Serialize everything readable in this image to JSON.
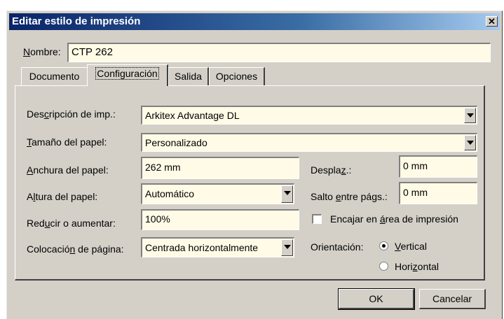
{
  "window": {
    "title": "Editar estilo de impresión",
    "close_symbol": "✕"
  },
  "nombre": {
    "label_u": "N",
    "label_rest": "ombre:",
    "value": "CTP 262"
  },
  "tabs": [
    {
      "label": "Documento"
    },
    {
      "label": "Configuración",
      "active": true
    },
    {
      "label": "Salida"
    },
    {
      "label": "Opciones"
    }
  ],
  "config": {
    "descripcion": {
      "pre": "Des",
      "u": "c",
      "post": "ripción de imp.:",
      "value": "Arkitex Advantage DL"
    },
    "tamano": {
      "pre": "",
      "u": "T",
      "post": "amaño del papel:",
      "value": "Personalizado"
    },
    "anchura": {
      "pre": "",
      "u": "A",
      "post": "nchura del papel:",
      "value": "262 mm"
    },
    "altura": {
      "pre": "A",
      "u": "l",
      "post": "tura del papel:",
      "value": "Automático"
    },
    "reducir": {
      "pre": "Red",
      "u": "u",
      "post": "cir o aumentar:",
      "value": "100%"
    },
    "colocacion": {
      "pre": "Colocació",
      "u": "n",
      "post": " de página:",
      "value": "Centrada horizontalmente"
    },
    "desplaz": {
      "pre": "Despla",
      "u": "z",
      "post": ".:",
      "value": "0 mm"
    },
    "salto": {
      "pre": "Salto ",
      "u": "e",
      "post": "ntre págs.:",
      "value": "0 mm"
    },
    "encajar": {
      "pre": "Encajar en ",
      "u": "á",
      "post": "rea de impresión",
      "checked": false
    },
    "orientacion": {
      "label": "Orientación:",
      "vertical": {
        "u": "V",
        "rest": "ertical",
        "selected": true
      },
      "horizontal": {
        "pre": "Hori",
        "u": "z",
        "post": "ontal",
        "selected": false
      }
    }
  },
  "buttons": {
    "ok": "OK",
    "cancel": "Cancelar"
  }
}
